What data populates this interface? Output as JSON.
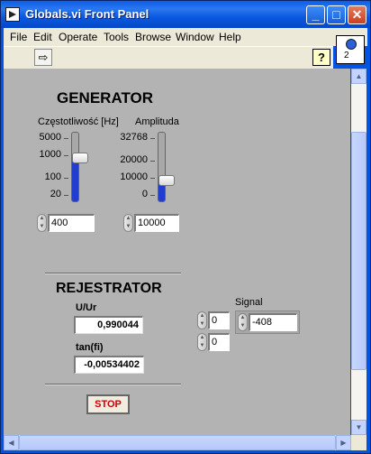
{
  "window": {
    "title": "Globals.vi Front Panel",
    "buttons": {
      "minimize": "_",
      "maximize": "□",
      "close": "✕"
    }
  },
  "menu": [
    "File",
    "Edit",
    "Operate",
    "Tools",
    "Browse",
    "Window",
    "Help"
  ],
  "toolbar": {
    "run_icon": "⇨",
    "help_icon": "?"
  },
  "connector": {
    "number": "2"
  },
  "generator": {
    "title": "GENERATOR",
    "frequency": {
      "label": "Częstotliwość [Hz]",
      "ticks": [
        "5000",
        "1000",
        "100",
        "20"
      ],
      "value": "400",
      "slider_level": 0.65
    },
    "amplitude": {
      "label": "Amplituda",
      "ticks": [
        "32768",
        "20000",
        "10000",
        "0"
      ],
      "value": "10000",
      "slider_level": 0.31
    }
  },
  "rejestrator": {
    "title": "REJESTRATOR",
    "uur_label": "U/Ur",
    "uur_value": "0,990044",
    "tanfi_label": "tan(fi)",
    "tanfi_value": "-0,00534402"
  },
  "signal": {
    "label": "Signal",
    "index_row": "0",
    "index_col": "0",
    "value": "-408"
  },
  "stop_label": "STOP"
}
